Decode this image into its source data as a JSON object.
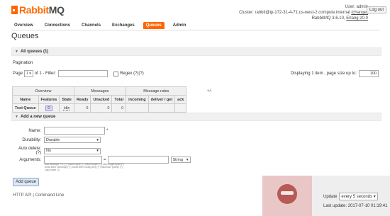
{
  "brand": {
    "rabbit": "Rabbit",
    "mq": "MQ"
  },
  "header": {
    "user_label": "User:",
    "user": "admin",
    "cluster_label": "Cluster:",
    "cluster": "rabbit@ip-172-31-4-71.us-west-2.compute.internal",
    "change": "(change)",
    "version_line": "RabbitMQ 3.6.10,",
    "erlang": "Erlang 20.0",
    "logout": "Log out"
  },
  "tabs": [
    {
      "label": "Overview"
    },
    {
      "label": "Connections"
    },
    {
      "label": "Channels"
    },
    {
      "label": "Exchanges"
    },
    {
      "label": "Queues",
      "active": true
    },
    {
      "label": "Admin"
    }
  ],
  "page_title": "Queues",
  "all_queues_section": "All queues (1)",
  "pagination": {
    "title": "Pagination",
    "page_label": "Page",
    "page_value": "1",
    "of_label": "of 1",
    "filter_label": "- Filter:",
    "regex_label": "Regex",
    "regex_help": "(?)(?)",
    "displaying": "Displaying 1 item , page size up to:",
    "page_size": "100"
  },
  "table": {
    "groups": [
      "Overview",
      "Messages",
      "Message rates"
    ],
    "plus_minus": "+/-",
    "columns": [
      "Name",
      "Features",
      "State",
      "Ready",
      "Unacked",
      "Total",
      "incoming",
      "deliver / get",
      "ack"
    ],
    "rows": [
      {
        "name": "Test Queue",
        "features": "D",
        "state": "idle",
        "ready": "0",
        "unacked": "0",
        "total": "0",
        "incoming": "",
        "deliver_get": "",
        "ack": ""
      }
    ]
  },
  "add_queue": {
    "section": "Add a new queue",
    "name_label": "Name:",
    "required_mark": "*",
    "durability_label": "Durability:",
    "durability_value": "Durable",
    "autodelete_label": "Auto delete:",
    "autodelete_help": "(?)",
    "autodelete_value": "No",
    "arguments_label": "Arguments:",
    "equals": "=",
    "type_value": "String",
    "help_lines": [
      "Add   Message TTL (?) | Auto expire (?) | Max length (?) | Max length bytes (?)",
      "        Dead letter exchange (?) | Dead letter routing key (?) | Maximum priority (?)",
      "        Lazy mode (?)"
    ],
    "button": "Add queue"
  },
  "footer": {
    "http_api": "HTTP API",
    "cmdline": "Command Line"
  },
  "update": {
    "label": "Update",
    "every": "every 5 seconds",
    "last_label": "Last update:",
    "last_value": "2017-07-10 01:19:41"
  },
  "colors": {
    "accent": "#ff6600",
    "bar": "#f0f0f0",
    "avatar_bg": "#e9c7c6",
    "avatar_face": "#b65a55"
  }
}
